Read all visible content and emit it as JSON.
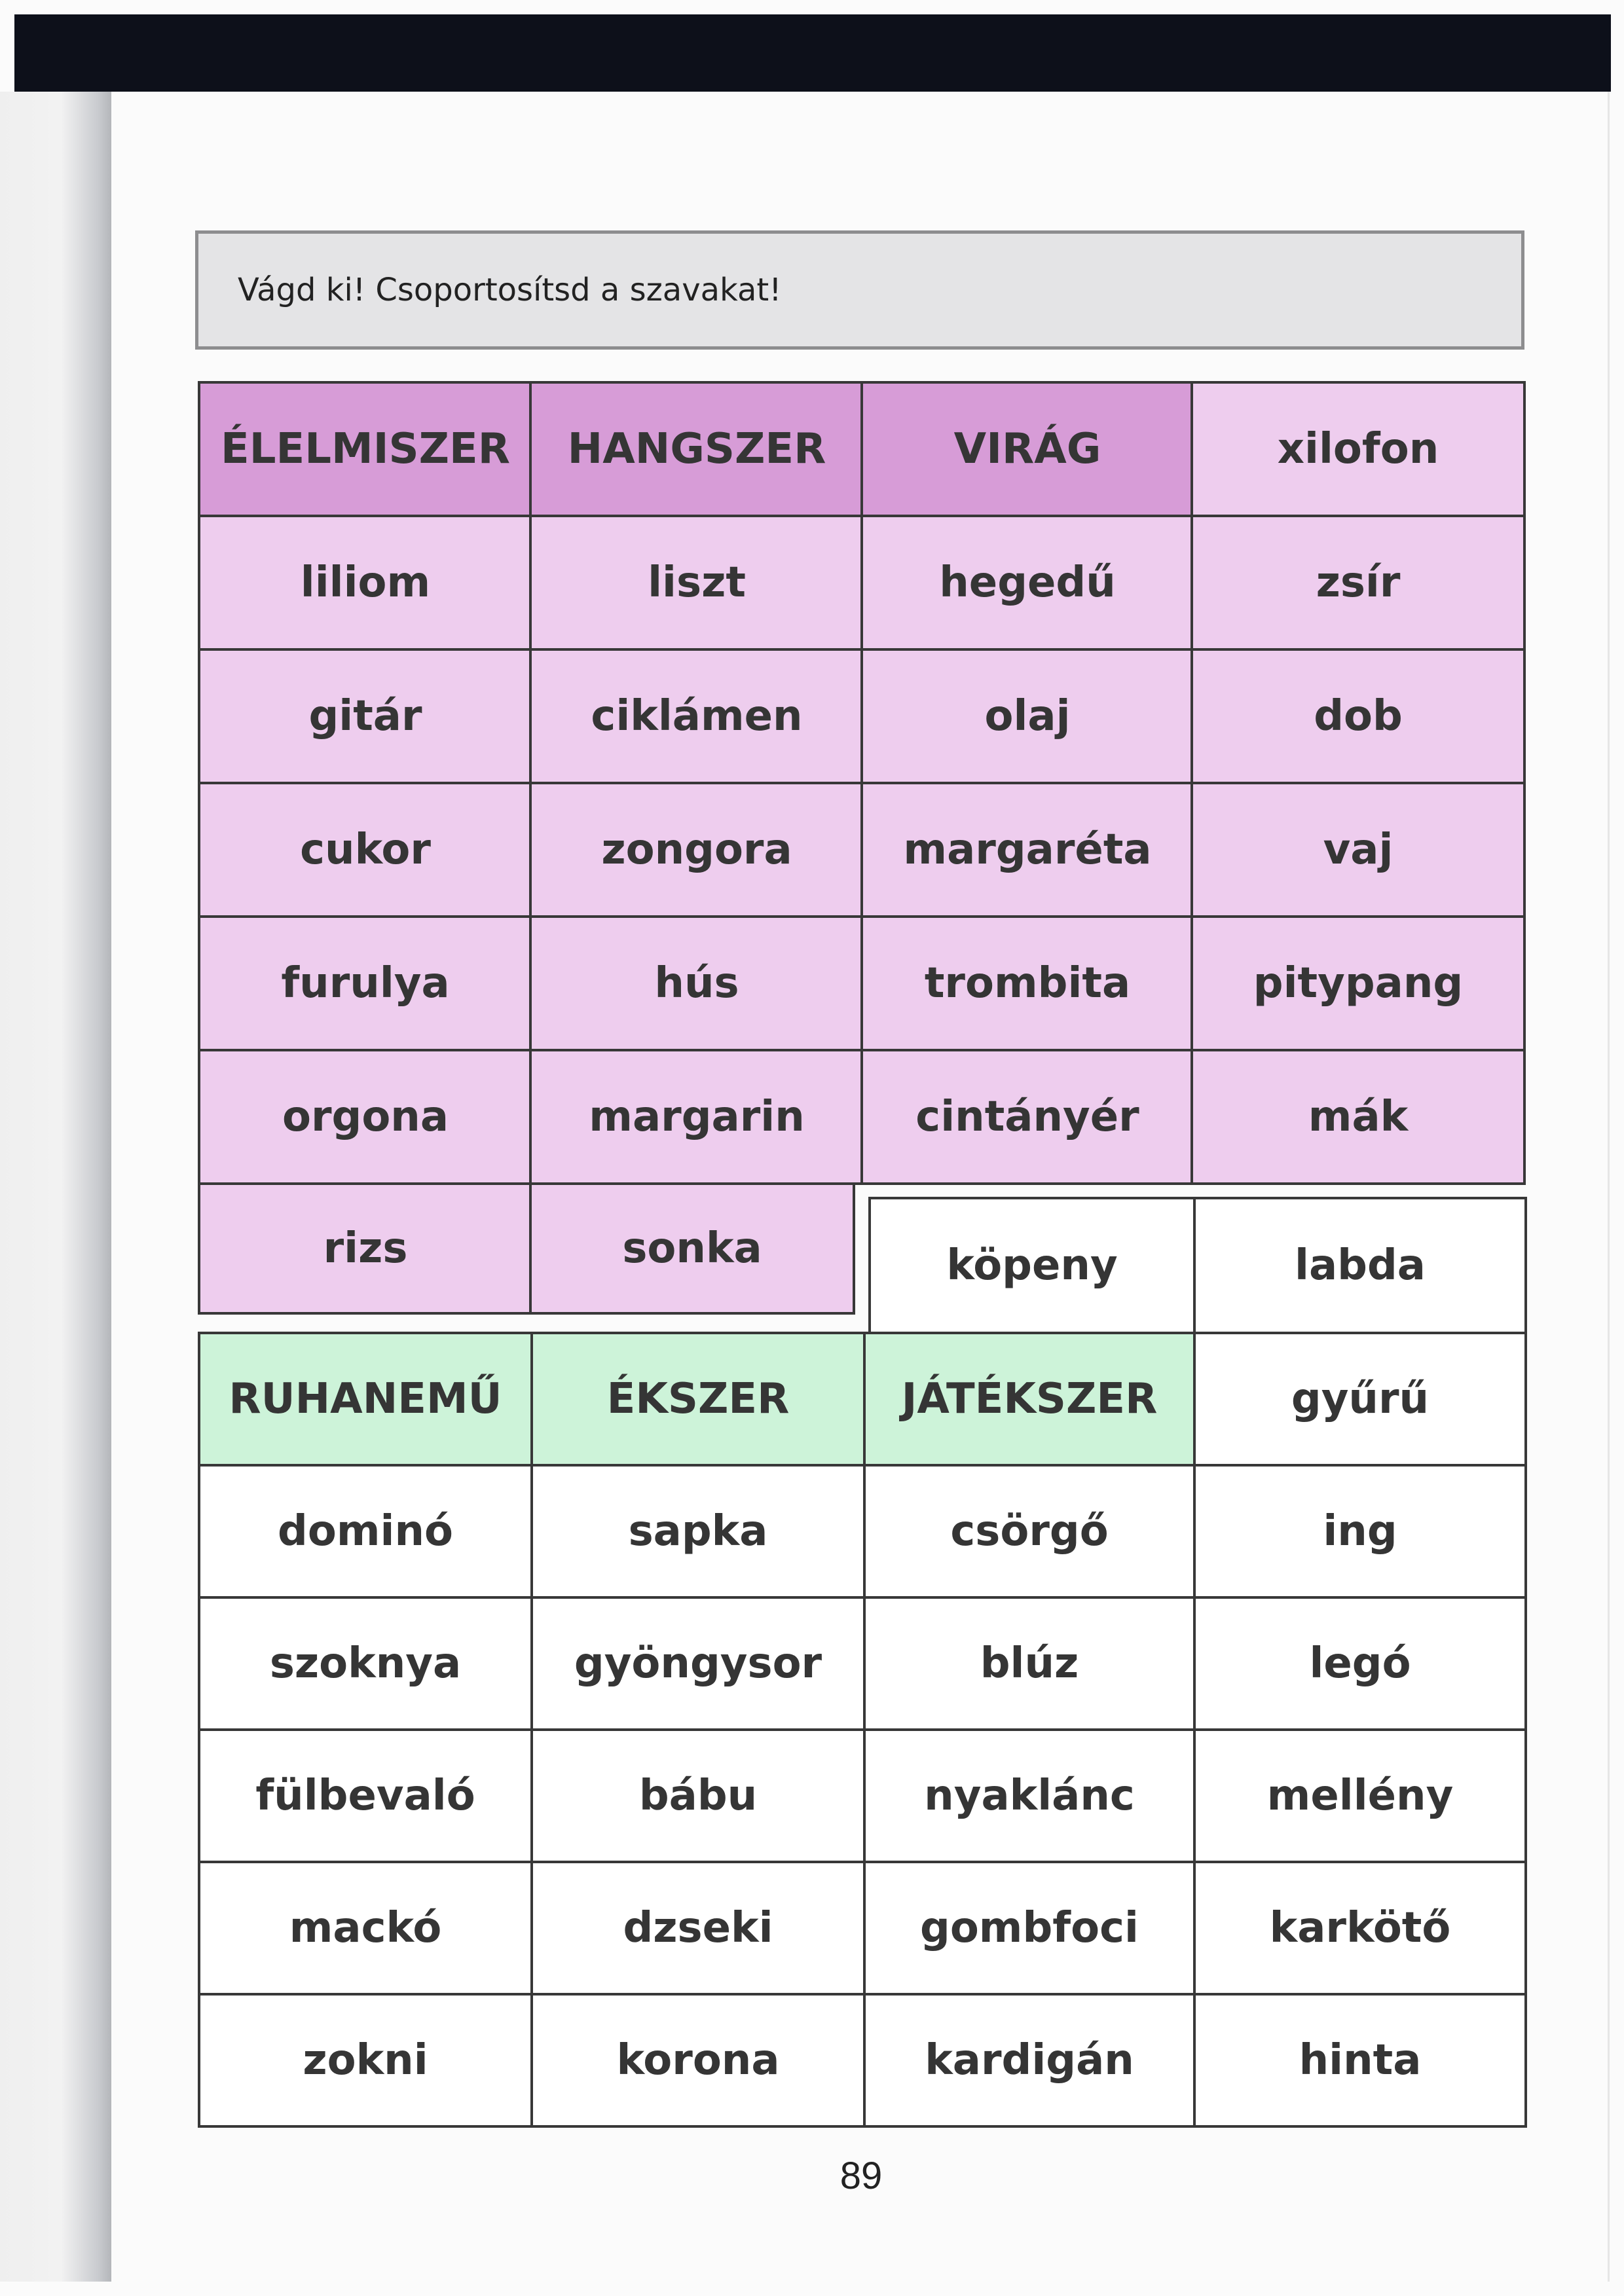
{
  "instruction": "Vágd ki! Csoportosítsd a szavakat!",
  "grid1": {
    "row1": [
      "ÉLELMISZER",
      "HANGSZER",
      "VIRÁG",
      "xilofon"
    ],
    "row2": [
      "liliom",
      "liszt",
      "hegedű",
      "zsír"
    ],
    "row3": [
      "gitár",
      "ciklámen",
      "olaj",
      "dob"
    ],
    "row4": [
      "cukor",
      "zongora",
      "margaréta",
      "vaj"
    ],
    "row5": [
      "furulya",
      "hús",
      "trombita",
      "pitypang"
    ],
    "row6": [
      "orgona",
      "margarin",
      "cintányér",
      "mák"
    ],
    "row7": [
      "rizs",
      "sonka"
    ]
  },
  "grid2": {
    "top": [
      "köpeny",
      "labda"
    ],
    "row1": [
      "RUHANEMŰ",
      "ÉKSZER",
      "JÁTÉKSZER",
      "gyűrű"
    ],
    "row2": [
      "dominó",
      "sapka",
      "csörgő",
      "ing"
    ],
    "row3": [
      "szoknya",
      "gyöngysor",
      "blúz",
      "legó"
    ],
    "row4": [
      "fülbevaló",
      "bábu",
      "nyaklánc",
      "mellény"
    ],
    "row5": [
      "mackó",
      "dzseki",
      "gombfoci",
      "karkötő"
    ],
    "row6": [
      "zokni",
      "korona",
      "kardigán",
      "hinta"
    ]
  },
  "page_number": "89",
  "colors": {
    "purple_cell": "#eecdee",
    "purple_header": "#d79cd7",
    "green_header": "#cdf3d9",
    "white_cell": "#ffffff",
    "top_bar": "#0d101a"
  }
}
